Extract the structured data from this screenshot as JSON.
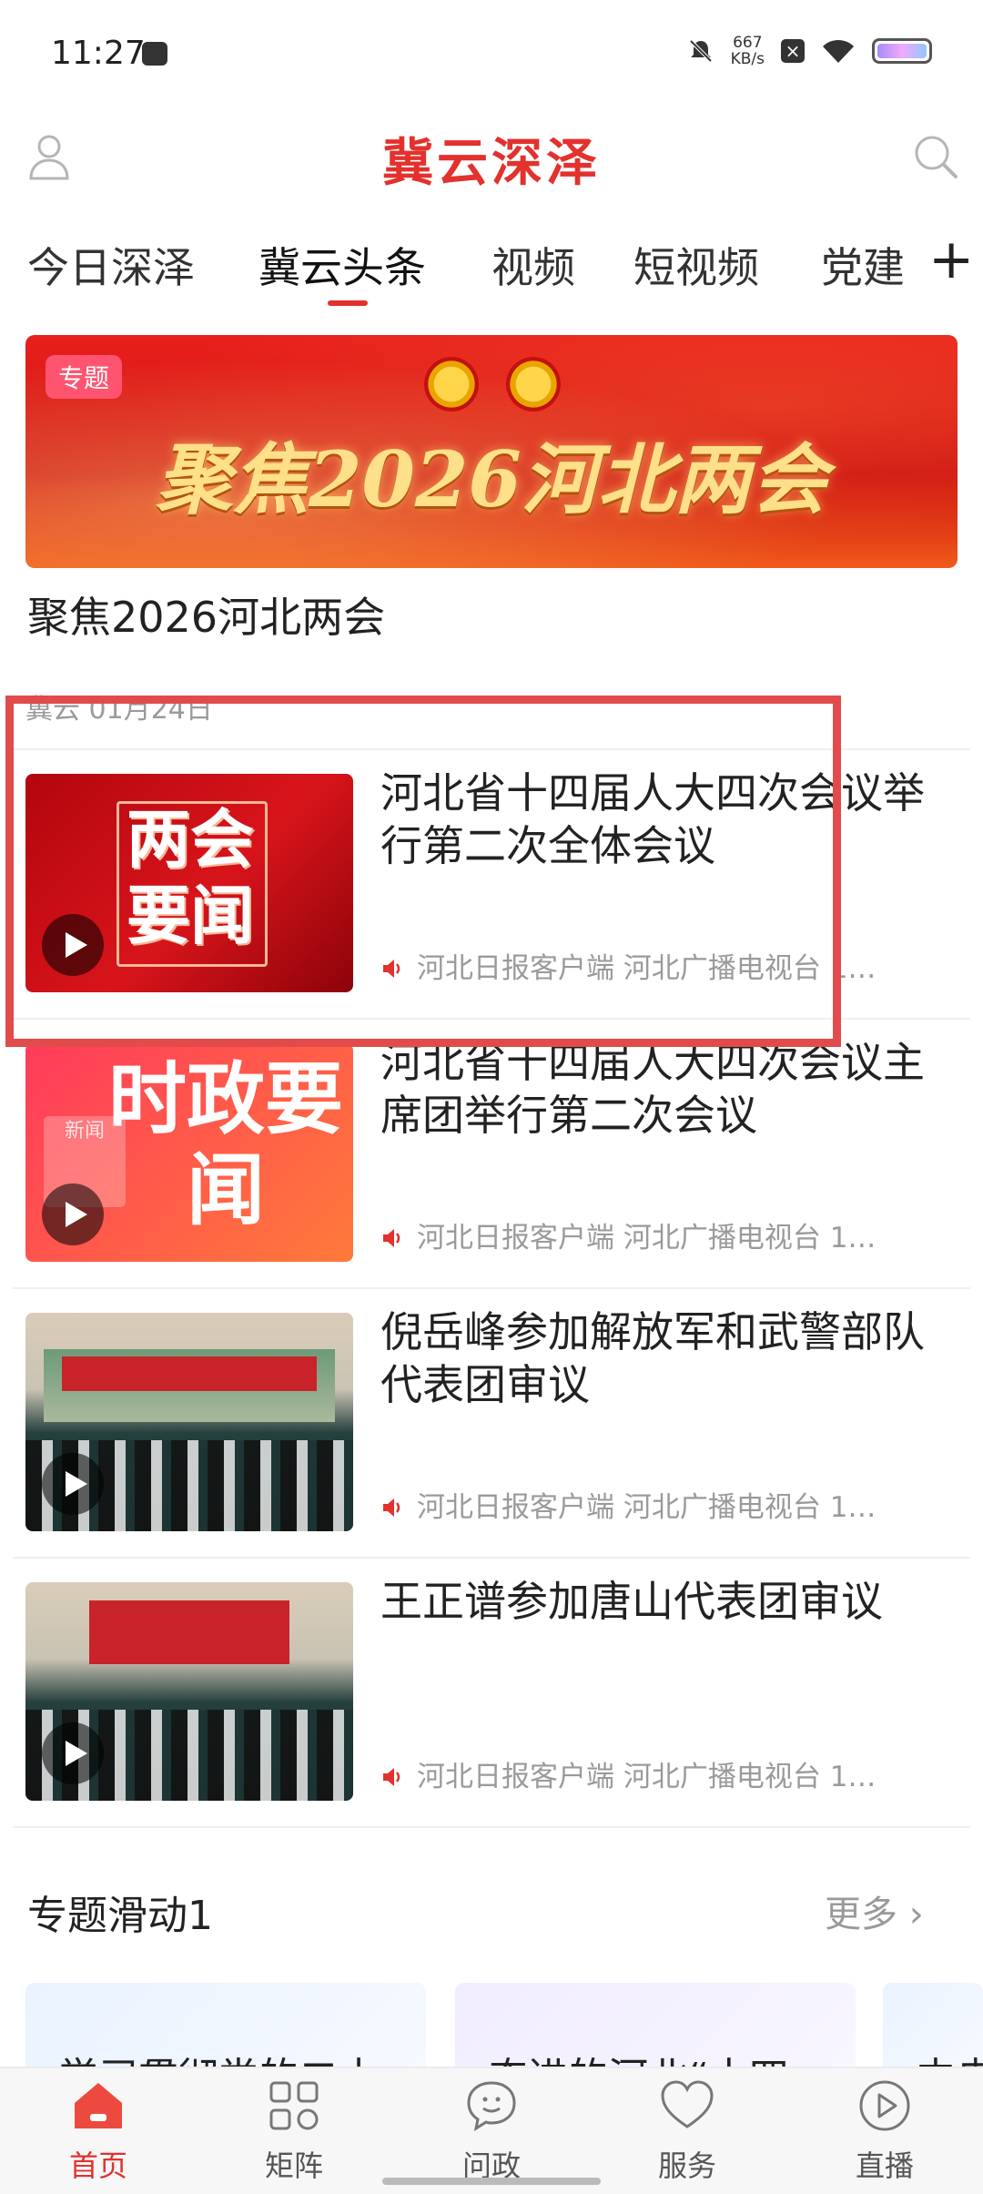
{
  "status_bar": {
    "time": "11:27",
    "speed_value": "667",
    "speed_unit": "KB/s"
  },
  "header": {
    "title": "冀云深泽"
  },
  "tabs": [
    {
      "label": "今日深泽"
    },
    {
      "label": "冀云头条",
      "active": true
    },
    {
      "label": "视频"
    },
    {
      "label": "短视频"
    },
    {
      "label": "党建"
    }
  ],
  "banner": {
    "tag": "专题",
    "image_text": "聚焦2026河北两会",
    "title": "聚焦2026河北两会",
    "meta": "冀云  01月24日"
  },
  "news": [
    {
      "title": "河北省十四届人大四次会议举行第二次全体会议",
      "meta": "河北日报客户端 河北广播电视台 1…",
      "thumb_text": "两会要闻",
      "video": true
    },
    {
      "title": "河北省十四届人大四次会议主席团举行第二次会议",
      "meta": "河北日报客户端 河北广播电视台 1…",
      "thumb_text": "时政要闻",
      "thumb_sub": "新闻",
      "video": true
    },
    {
      "title": "倪岳峰参加解放军和武警部队代表团审议",
      "meta": "河北日报客户端 河北广播电视台 1…",
      "video": true
    },
    {
      "title": "王正谱参加唐山代表团审议",
      "meta": "河北日报客户端 河北广播电视台 1…",
      "video": true
    }
  ],
  "section": {
    "title": "专题滑动1",
    "more": "更多 ›",
    "cards": [
      {
        "title": "学习贯彻党的二十"
      },
      {
        "title": "奋进的河北“十四"
      },
      {
        "title": "中央"
      }
    ]
  },
  "bottom_nav": [
    {
      "label": "首页",
      "icon": "home-icon",
      "active": true
    },
    {
      "label": "矩阵",
      "icon": "grid-icon"
    },
    {
      "label": "问政",
      "icon": "chat-icon"
    },
    {
      "label": "服务",
      "icon": "heart-icon"
    },
    {
      "label": "直播",
      "icon": "play-circle-icon"
    }
  ],
  "colors": {
    "accent": "#e3312d",
    "highlight": "#e24b4b"
  }
}
